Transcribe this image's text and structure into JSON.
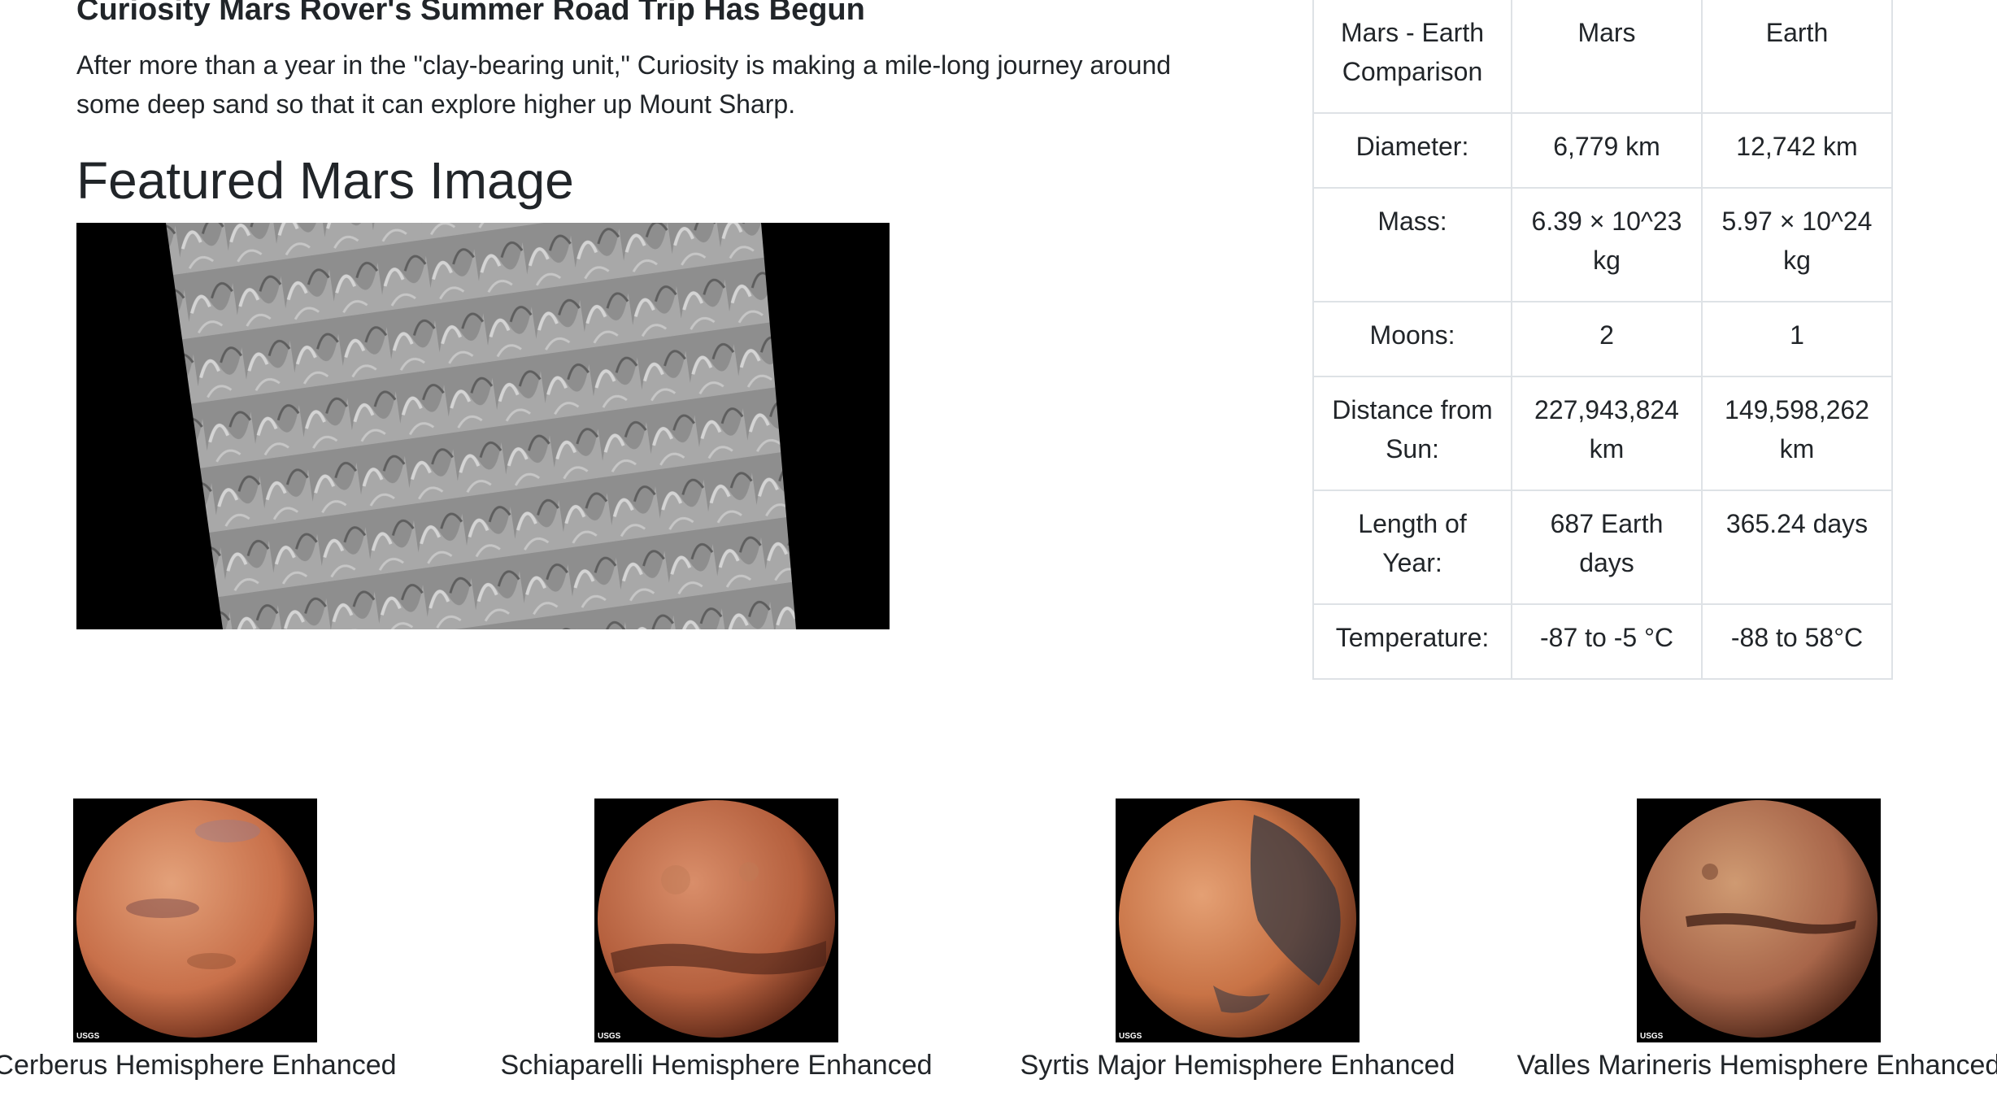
{
  "news": {
    "title": "Curiosity Mars Rover's Summer Road Trip Has Begun",
    "teaser": "After more than a year in the \"clay-bearing unit,\" Curiosity is making a mile-long journey around some deep sand so that it can explore higher up Mount Sharp."
  },
  "featured": {
    "heading": "Featured Mars Image"
  },
  "facts": {
    "header": [
      "Mars - Earth Comparison",
      "Mars",
      "Earth"
    ],
    "rows": [
      [
        "Diameter:",
        "6,779 km",
        "12,742 km"
      ],
      [
        "Mass:",
        "6.39 × 10^23 kg",
        "5.97 × 10^24 kg"
      ],
      [
        "Moons:",
        "2",
        "1"
      ],
      [
        "Distance from Sun:",
        "227,943,824 km",
        "149,598,262 km"
      ],
      [
        "Length of Year:",
        "687 Earth days",
        "365.24 days"
      ],
      [
        "Temperature:",
        "-87 to -5 °C",
        "-88 to 58°C"
      ]
    ]
  },
  "hemispheres": [
    {
      "title": "Cerberus Hemisphere Enhanced",
      "badge": "USGS"
    },
    {
      "title": "Schiaparelli Hemisphere Enhanced",
      "badge": "USGS"
    },
    {
      "title": "Syrtis Major Hemisphere Enhanced",
      "badge": "USGS"
    },
    {
      "title": "Valles Marineris Hemisphere Enhanced",
      "badge": "USGS"
    }
  ],
  "colors": {
    "text": "#212529",
    "table_border": "#dee2e6",
    "mars_light": "#d98a62",
    "mars_dark": "#8a3f24"
  }
}
